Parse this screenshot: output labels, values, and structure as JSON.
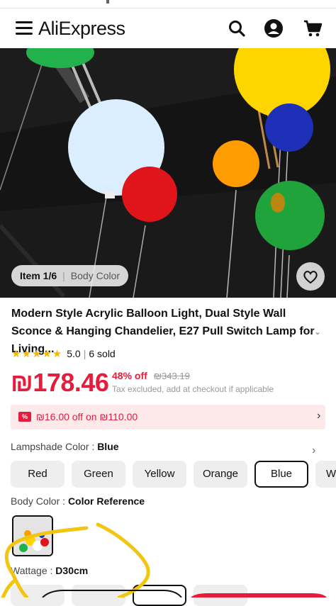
{
  "header": {
    "logo": "AliExpress",
    "menu_icon": "menu-icon",
    "search_icon": "search-icon",
    "account_icon": "account-icon",
    "cart_icon": "cart-icon"
  },
  "gallery": {
    "item_label": "Item 1/6",
    "item_variant": "Body Color",
    "wishlist_icon": "heart-icon"
  },
  "product": {
    "title": "Modern Style Acrylic Balloon Light, Dual Style Wall Sconce & Hanging Chandelier, E27 Pull Switch Lamp for Living...",
    "rating": "5.0",
    "sold": "6 sold",
    "rating_stars": 5,
    "price": "₪178.46",
    "discount": "48% off",
    "original_price": "₪343.19",
    "tax_note": "Tax excluded, add at checkout if applicable",
    "coupon": "₪16.00 off on ₪110.00"
  },
  "options": {
    "lampshade_label": "Lampshade Color",
    "lampshade_value": "Blue",
    "lampshade_choices": [
      "Red",
      "Green",
      "Yellow",
      "Orange",
      "Blue",
      "W"
    ],
    "lampshade_selected": "Blue",
    "body_label": "Body Color",
    "body_value": "Color Reference",
    "wattage_label": "Wattage",
    "wattage_value": "D30cm"
  },
  "colors": {
    "accent": "#e51c3b",
    "coupon_bg": "#fde8ea",
    "star": "#f5b800",
    "annotation": "#f2c511"
  }
}
